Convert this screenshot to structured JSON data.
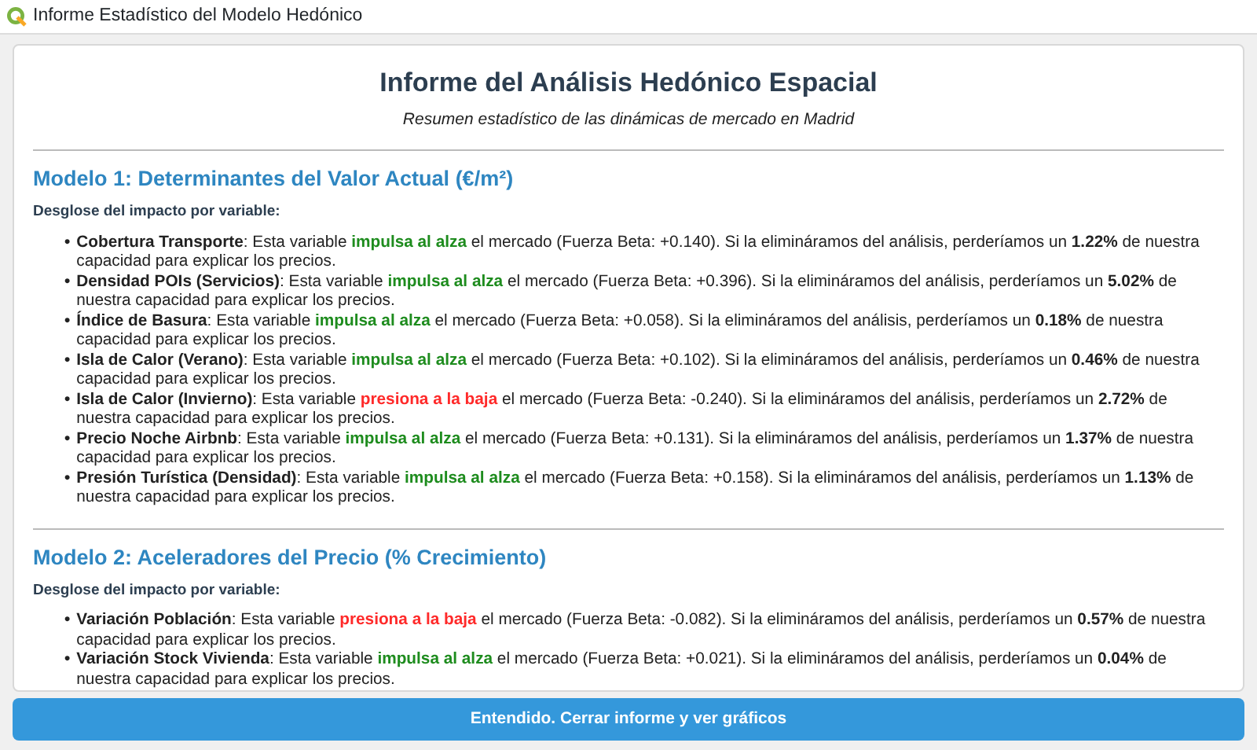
{
  "window": {
    "title": "Informe Estadístico del Modelo Hedónico"
  },
  "report": {
    "title": "Informe del Análisis Hedónico Espacial",
    "subtitle": "Resumen estadístico de las dinámicas de mercado en Madrid"
  },
  "sections": [
    {
      "heading": "Modelo 1: Determinantes del Valor Actual (€/m²)",
      "intro": "Desglose del impacto por variable:",
      "items": [
        {
          "bullet": "•",
          "variable": "Cobertura Transporte",
          "lead": ": Esta variable ",
          "effect": "impulsa al alza",
          "color": "#1e8c1e",
          "rest": " el mercado (Fuerza Beta: +0.140). Si la elimináramos del análisis, perderíamos un **1.22%** de nuestra capacidad para explicar los precios."
        },
        {
          "bullet": "•",
          "variable": "Densidad POIs (Servicios)",
          "lead": ": Esta variable ",
          "effect": "impulsa al alza",
          "color": "#1e8c1e",
          "rest": " el mercado (Fuerza Beta: +0.396). Si la elimináramos del análisis, perderíamos un **5.02%** de nuestra capacidad para explicar los precios."
        },
        {
          "bullet": "•",
          "variable": "Índice de Basura",
          "lead": ": Esta variable ",
          "effect": "impulsa al alza",
          "color": "#1e8c1e",
          "rest": " el mercado (Fuerza Beta: +0.058). Si la elimináramos del análisis, perderíamos un **0.18%** de nuestra capacidad para explicar los precios."
        },
        {
          "bullet": "•",
          "variable": "Isla de Calor (Verano)",
          "lead": ": Esta variable ",
          "effect": "impulsa al alza",
          "color": "#1e8c1e",
          "rest": " el mercado (Fuerza Beta: +0.102). Si la elimináramos del análisis, perderíamos un **0.46%** de nuestra capacidad para explicar los precios."
        },
        {
          "bullet": "•",
          "variable": "Isla de Calor (Invierno)",
          "lead": ": Esta variable ",
          "effect": "presiona a la baja",
          "color": "#ff2a2a",
          "rest": " el mercado (Fuerza Beta: -0.240). Si la elimináramos del análisis, perderíamos un **2.72%** de nuestra capacidad para explicar los precios."
        },
        {
          "bullet": "•",
          "variable": "Precio Noche Airbnb",
          "lead": ": Esta variable ",
          "effect": "impulsa al alza",
          "color": "#1e8c1e",
          "rest": " el mercado (Fuerza Beta: +0.131). Si la elimináramos del análisis, perderíamos un **1.37%** de nuestra capacidad para explicar los precios."
        },
        {
          "bullet": "•",
          "variable": "Presión Turística (Densidad)",
          "lead": ": Esta variable ",
          "effect": "impulsa al alza",
          "color": "#1e8c1e",
          "rest": " el mercado (Fuerza Beta: +0.158). Si la elimináramos del análisis, perderíamos un **1.13%** de nuestra capacidad para explicar los precios."
        }
      ]
    },
    {
      "heading": "Modelo 2: Aceleradores del Precio (% Crecimiento)",
      "intro": "Desglose del impacto por variable:",
      "items": [
        {
          "bullet": "•",
          "variable": "Variación Población",
          "lead": ": Esta variable ",
          "effect": "presiona a la baja",
          "color": "#ff2a2a",
          "rest": " el mercado (Fuerza Beta: -0.082). Si la elimináramos del análisis, perderíamos un **0.57%** de nuestra capacidad para explicar los precios."
        },
        {
          "bullet": "•",
          "variable": "Variación Stock Vivienda",
          "lead": ": Esta variable ",
          "effect": "impulsa al alza",
          "color": "#1e8c1e",
          "rest": " el mercado (Fuerza Beta: +0.021). Si la elimináramos del análisis, perderíamos un **0.04%** de nuestra capacidad para explicar los precios."
        }
      ]
    }
  ],
  "button": "Entendido. Cerrar informe y ver gráficos"
}
